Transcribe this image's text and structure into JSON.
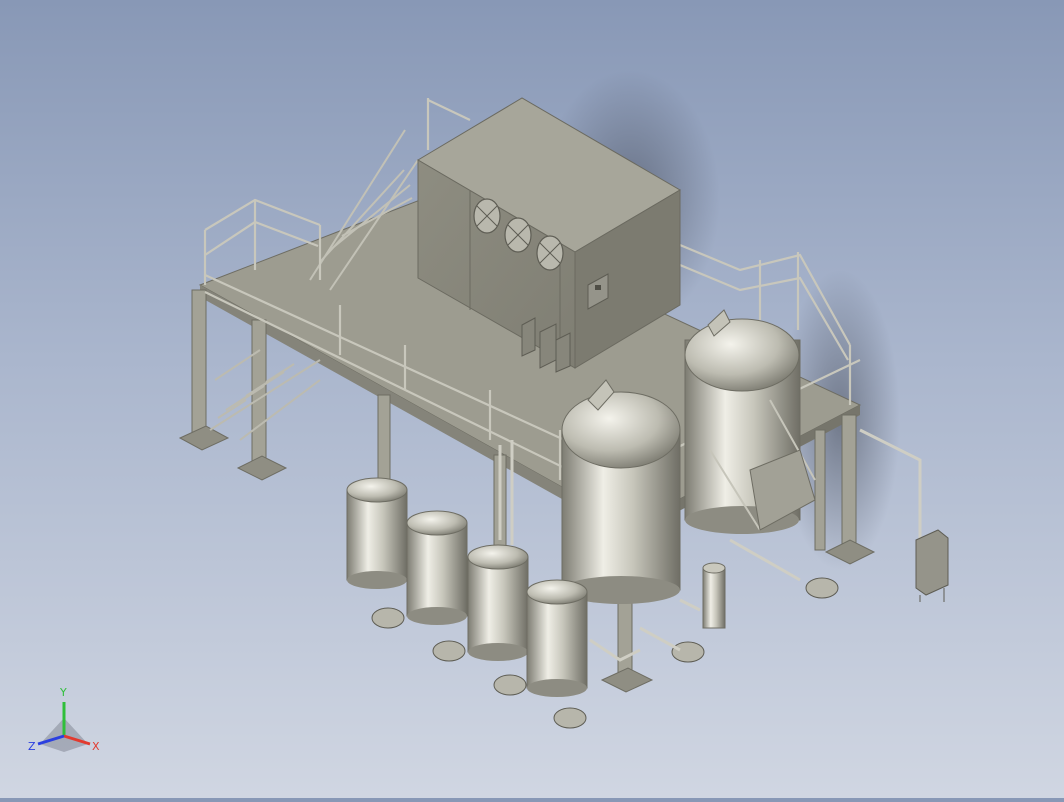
{
  "window": {
    "title": ""
  },
  "model": {
    "description_free": true,
    "panel_status_icon": "control-cabinet"
  },
  "view_triad": {
    "x_label": "X",
    "y_label": "Y",
    "z_label": "Z",
    "x_color": "#e23a2f",
    "y_color": "#2fbf3a",
    "z_color": "#2b3fe0"
  },
  "colors": {
    "steel": "#a9a89c",
    "steel_dark": "#8b8a7f",
    "steel_light": "#c9c8bd",
    "platform": "#9e9d91",
    "cube": "#8f8e82",
    "tank_light": "#e8e7df",
    "tank_dark": "#8a897f"
  }
}
